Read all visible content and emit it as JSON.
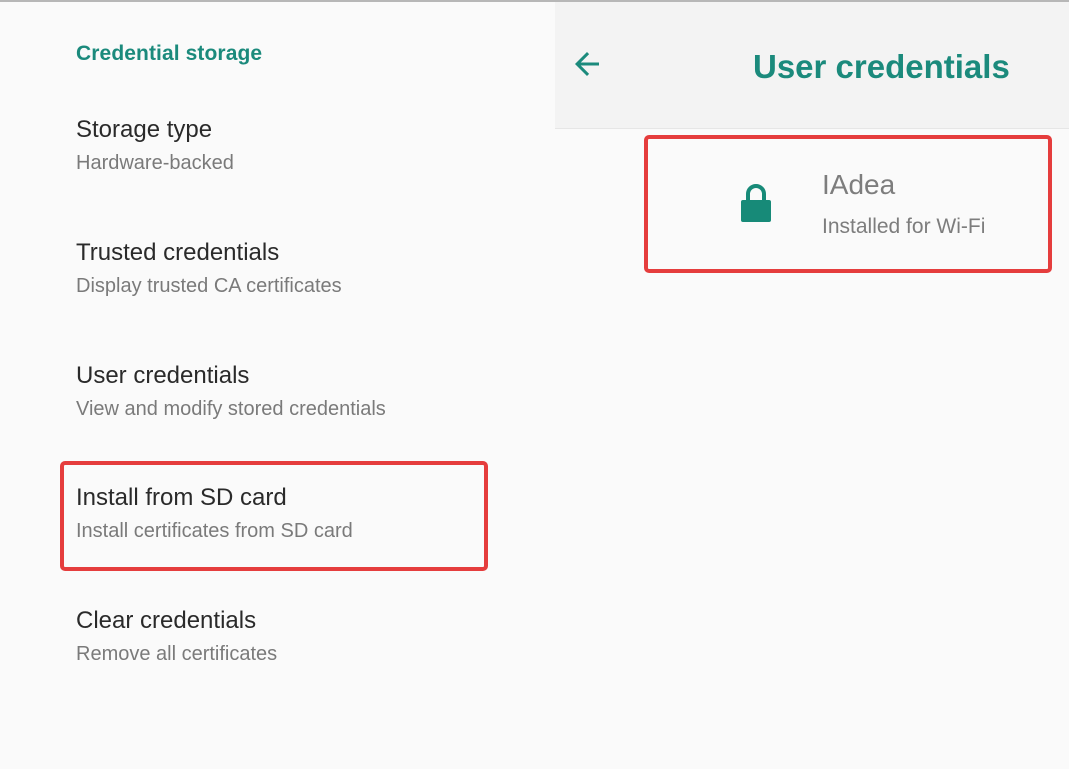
{
  "left": {
    "section_title": "Credential storage",
    "items": [
      {
        "title": "Storage type",
        "summary": "Hardware-backed"
      },
      {
        "title": "Trusted credentials",
        "summary": "Display trusted CA certificates"
      },
      {
        "title": "User credentials",
        "summary": "View and modify stored credentials"
      },
      {
        "title": "Install from SD card",
        "summary": "Install certificates from SD card"
      },
      {
        "title": "Clear credentials",
        "summary": "Remove all certificates"
      }
    ]
  },
  "right": {
    "appbar_title": "User credentials",
    "back_icon": "arrow-left-icon",
    "credential": {
      "icon": "lock-icon",
      "name": "IAdea",
      "summary": "Installed for Wi-Fi"
    }
  },
  "colors": {
    "accent": "#1b8a7c",
    "highlight": "#e53d3d"
  }
}
